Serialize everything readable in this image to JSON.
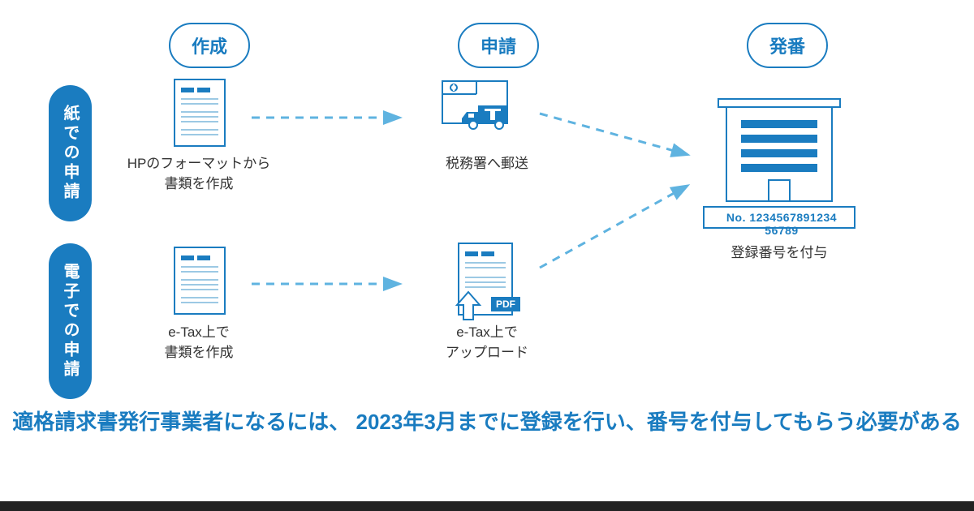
{
  "steps": {
    "create": "作成",
    "apply": "申請",
    "issue": "発番"
  },
  "rows": {
    "paper": "紙での申請",
    "electronic": "電子での申請"
  },
  "captions": {
    "paper_create": "HPのフォーマットから\n書類を作成",
    "paper_apply": "税務署へ郵送",
    "electronic_create": "e-Tax上で\n書類を作成",
    "electronic_apply": "e-Tax上で\nアップロード",
    "issue": "登録番号を付与"
  },
  "registration_number": "No. 1234567891234 56789",
  "pdf_badge": "PDF",
  "summary": "適格請求書発行事業者になるには、\n2023年3月までに登録を行い、番号を付与してもらう必要がある",
  "colors": {
    "primary": "#1a7cc0",
    "light": "#5fb3e0",
    "text": "#333"
  }
}
